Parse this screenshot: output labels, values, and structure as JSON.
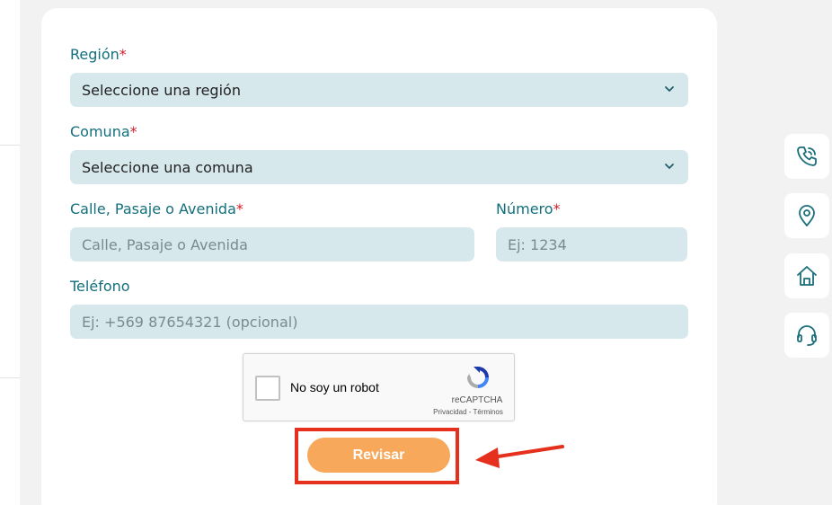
{
  "form": {
    "region_label": "Región",
    "region_required": "*",
    "region_value": "Seleccione una región",
    "comuna_label": "Comuna",
    "comuna_required": "*",
    "comuna_value": "Seleccione una comuna",
    "street_label": "Calle, Pasaje o Avenida",
    "street_required": "*",
    "street_placeholder": "Calle, Pasaje o Avenida",
    "number_label": "Número",
    "number_required": "*",
    "number_placeholder": "Ej: 1234",
    "phone_label": "Teléfono",
    "phone_placeholder": "Ej: +569 87654321 (opcional)",
    "submit_label": "Revisar"
  },
  "recaptcha": {
    "checkbox_label": "No soy un robot",
    "brand": "reCAPTCHA",
    "links": "Privacidad - Términos"
  },
  "side_toolbar": {
    "items": [
      "phone-icon",
      "location-pin-icon",
      "home-icon",
      "headset-icon"
    ]
  },
  "colors": {
    "label": "#136f7c",
    "required": "#d0202a",
    "input_bg": "#d7e8ec",
    "button": "#f8a85a",
    "highlight": "#e4301c"
  }
}
